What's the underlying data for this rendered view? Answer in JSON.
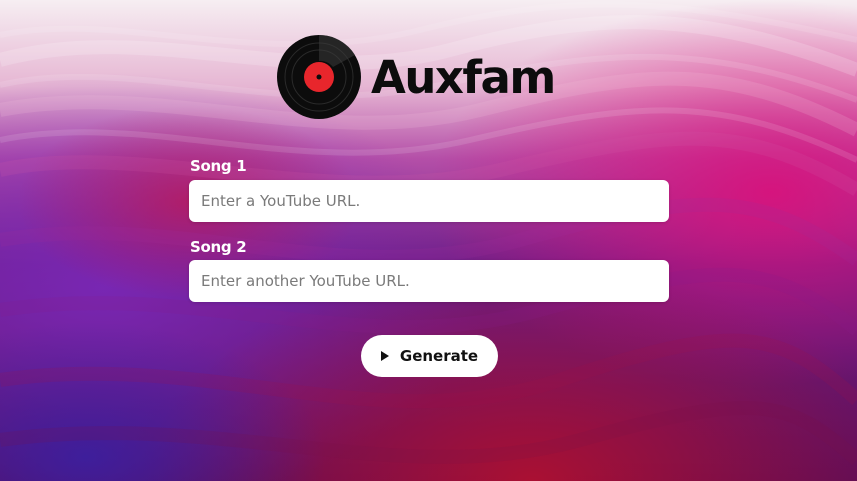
{
  "brand": {
    "name": "Auxfam",
    "logo_icon": "vinyl-record-icon",
    "accent_color": "#e8262c"
  },
  "form": {
    "song1": {
      "label": "Song 1",
      "placeholder": "Enter a YouTube URL.",
      "value": ""
    },
    "song2": {
      "label": "Song 2",
      "placeholder": "Enter another YouTube URL.",
      "value": ""
    },
    "generate": {
      "label": "Generate",
      "icon": "play-icon"
    }
  },
  "colors": {
    "background_primary": "#8a1aa8",
    "background_accent": "#c0107a",
    "background_dark": "#5a0a55",
    "text_on_dark": "#ffffff"
  }
}
